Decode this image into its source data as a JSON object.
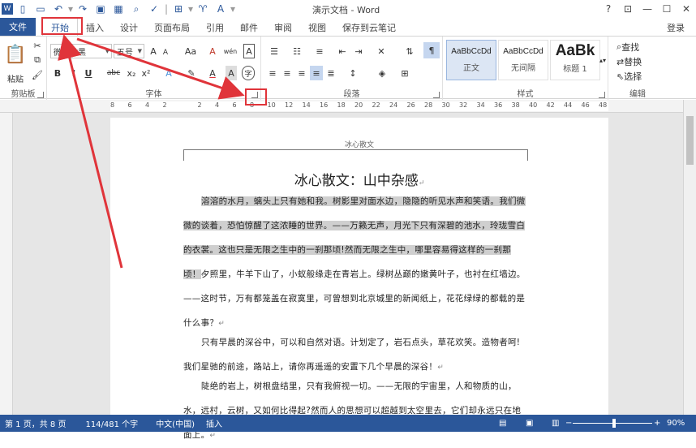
{
  "window": {
    "title": "演示文档 - Word",
    "help": "?",
    "controls": [
      "restore-ribbon",
      "minimize",
      "maximize",
      "close"
    ]
  },
  "quick_access": [
    "word-logo-icon",
    "new-doc-icon",
    "open-icon",
    "undo-icon",
    "redo-icon",
    "save-icon",
    "save-as-icon",
    "print-preview-icon",
    "spellcheck-icon",
    "table-icon",
    "format-painter-icon",
    "text-size-icon",
    "more-icon"
  ],
  "tabs": {
    "file": "文件",
    "items": [
      "开始",
      "插入",
      "设计",
      "页面布局",
      "引用",
      "邮件",
      "审阅",
      "视图",
      "保存到云笔记"
    ],
    "active": "开始",
    "login": "登录"
  },
  "ribbon": {
    "clipboard": {
      "label": "剪贴板",
      "paste": "粘贴"
    },
    "font": {
      "label": "字体",
      "font_name": "微软雅黑",
      "font_size": "五号",
      "bold": "B",
      "italic": "I",
      "underline": "U",
      "strike": "abc",
      "subscript": "x₂",
      "superscript": "x²",
      "grow": "A",
      "shrink": "A",
      "case": "Aa",
      "clear": "A",
      "phonetic": "wén",
      "border": "A",
      "highlight": "A",
      "color": "A",
      "shade": "A",
      "enclose": "字"
    },
    "paragraph": {
      "label": "段落"
    },
    "styles": {
      "label": "样式",
      "items": [
        {
          "sample": "AaBbCcDd",
          "name": "正文"
        },
        {
          "sample": "AaBbCcDd",
          "name": "无间隔"
        },
        {
          "sample": "AaBk",
          "name": "标题 1"
        }
      ]
    },
    "editing": {
      "label": "编辑",
      "find": "查找",
      "replace": "替换",
      "select": "选择"
    }
  },
  "ruler": {
    "ticks": [
      "8",
      "6",
      "4",
      "2",
      "",
      "2",
      "4",
      "6",
      "8",
      "10",
      "12",
      "14",
      "16",
      "18",
      "20",
      "22",
      "24",
      "26",
      "28",
      "30",
      "32",
      "34",
      "36",
      "38",
      "40",
      "42",
      "44",
      "46",
      "48"
    ]
  },
  "document": {
    "header": "冰心散文",
    "heading": "冰心散文：山中杂感",
    "paragraphs": [
      {
        "text": "溶溶的水月，螭头上只有她和我。树影里对面水边，隐隐的听见水声和笑语。我们微微的谈着，恐怕惊醒了这浓睡的世界。——万籁无声，月光下只有深碧的池水，玲珑雪白的衣裳。这也只是无限之生中的一刹那顷!然而无限之生中，哪里容易得这样的一刹那顷！",
        "highlighted": true
      },
      {
        "text": "夕照里，牛羊下山了，小蚁般缘走在青岩上。绿树丛巅的嫩黄叶子，也衬在红墙边。——这时节，万有都笼盖在寂寞里，可曾想到北京城里的新闻纸上，花花绿绿的都载的是什么事？",
        "highlighted": false
      },
      {
        "text": "只有早晨的深谷中，可以和自然对语。计划定了，岩石点头，草花欢笑。造物者呵!我们星驰的前途，路站上，请你再遥遥的安置下几个早晨的深谷！",
        "highlighted": false
      },
      {
        "text": "陡绝的岩上，树根盘结里，只有我俯视一切。——无限的宇宙里，人和物质的山，水，远村，云树，又如何比得起?然而人的思想可以超越到太空里去，它们却永远只在地面上。",
        "highlighted": false
      }
    ]
  },
  "status": {
    "page": "第 1 页，共 8 页",
    "words": "114/481 个字",
    "lang": "中文(中国)",
    "mode": "插入",
    "zoom": "90%",
    "zoom_level": 0.5
  },
  "colors": {
    "accent": "#2b579a",
    "annotation": "#e0343a",
    "selection": "#cfcfcf"
  }
}
